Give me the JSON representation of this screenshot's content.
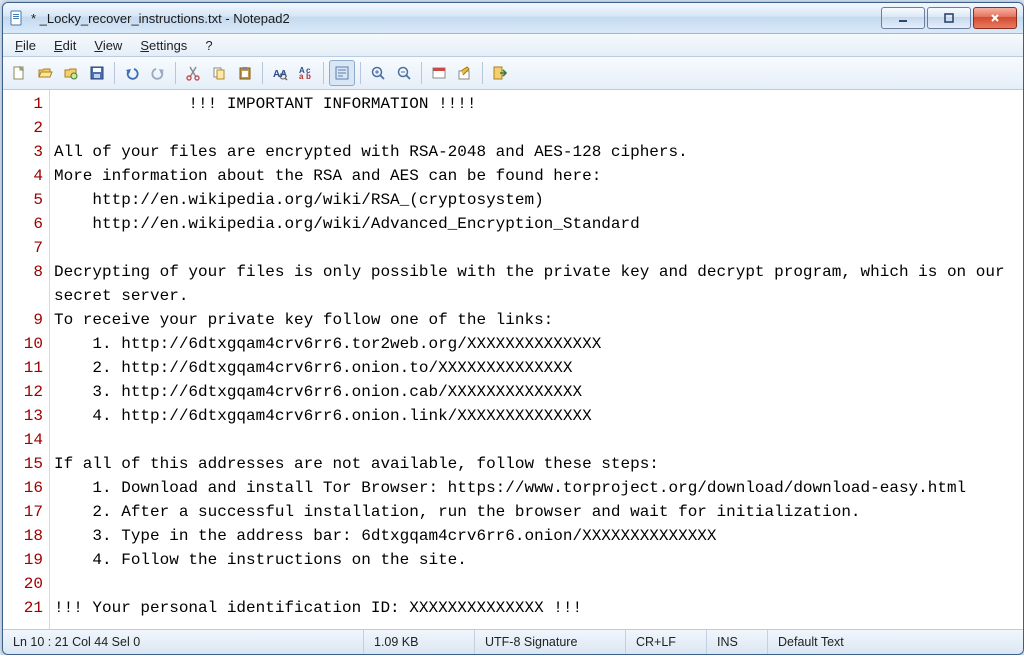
{
  "window": {
    "title": "* _Locky_recover_instructions.txt - Notepad2"
  },
  "menu": {
    "file": "File",
    "edit": "Edit",
    "view": "View",
    "settings": "Settings",
    "help": "?"
  },
  "lines": [
    "              !!! IMPORTANT INFORMATION !!!!",
    "",
    "All of your files are encrypted with RSA-2048 and AES-128 ciphers.",
    "More information about the RSA and AES can be found here:",
    "    http://en.wikipedia.org/wiki/RSA_(cryptosystem)",
    "    http://en.wikipedia.org/wiki/Advanced_Encryption_Standard",
    "",
    "Decrypting of your files is only possible with the private key and decrypt program, which is on our secret server.",
    "To receive your private key follow one of the links:",
    "    1. http://6dtxgqam4crv6rr6.tor2web.org/XXXXXXXXXXXXXX",
    "    2. http://6dtxgqam4crv6rr6.onion.to/XXXXXXXXXXXXXX",
    "    3. http://6dtxgqam4crv6rr6.onion.cab/XXXXXXXXXXXXXX",
    "    4. http://6dtxgqam4crv6rr6.onion.link/XXXXXXXXXXXXXX",
    "",
    "If all of this addresses are not available, follow these steps:",
    "    1. Download and install Tor Browser: https://www.torproject.org/download/download-easy.html",
    "    2. After a successful installation, run the browser and wait for initialization.",
    "    3. Type in the address bar: 6dtxgqam4crv6rr6.onion/XXXXXXXXXXXXXX",
    "    4. Follow the instructions on the site.",
    "",
    "!!! Your personal identification ID: XXXXXXXXXXXXXX !!!"
  ],
  "status": {
    "pos": "Ln 10 : 21   Col 44   Sel 0",
    "size": "1.09 KB",
    "encoding": "UTF-8 Signature",
    "eol": "CR+LF",
    "mode": "INS",
    "lexer": "Default Text"
  }
}
